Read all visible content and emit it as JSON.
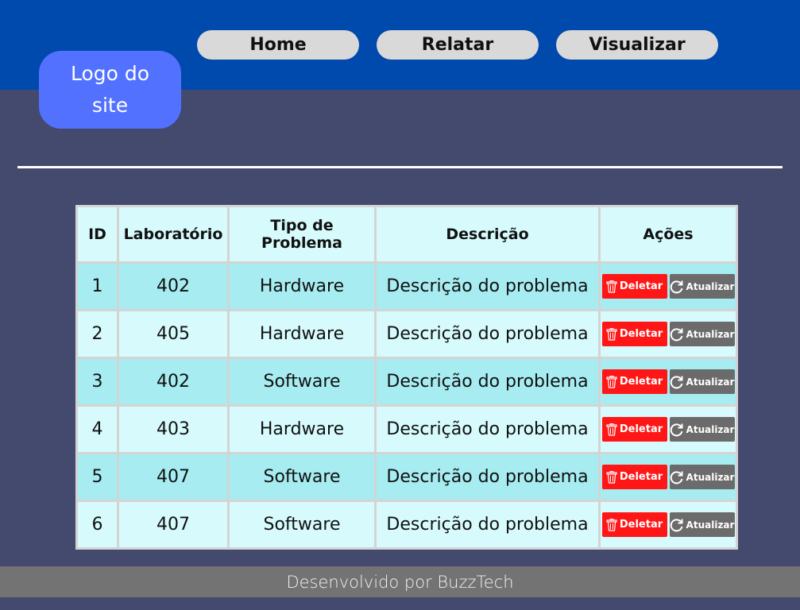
{
  "header": {
    "logo_text": "Logo do site",
    "nav": [
      {
        "label": "Home"
      },
      {
        "label": "Relatar"
      },
      {
        "label": "Visualizar"
      }
    ]
  },
  "table": {
    "headers": [
      "ID",
      "Laboratório",
      "Tipo de Problema",
      "Descrição",
      "Ações"
    ],
    "rows": [
      {
        "id": "1",
        "lab": "402",
        "type": "Hardware",
        "desc": "Descrição do problema"
      },
      {
        "id": "2",
        "lab": "405",
        "type": "Hardware",
        "desc": "Descrição do problema"
      },
      {
        "id": "3",
        "lab": "402",
        "type": "Software",
        "desc": "Descrição do problema"
      },
      {
        "id": "4",
        "lab": "403",
        "type": "Hardware",
        "desc": "Descrição do problema"
      },
      {
        "id": "5",
        "lab": "407",
        "type": "Software",
        "desc": "Descrição do problema"
      },
      {
        "id": "6",
        "lab": "407",
        "type": "Software",
        "desc": "Descrição do problema"
      }
    ],
    "delete_label": "Deletar",
    "update_label": "Atualizar",
    "delete_icon": "trash-icon",
    "update_icon": "refresh-icon"
  },
  "footer": {
    "text": "Desenvolvido por BuzzTech"
  },
  "colors": {
    "header_bg": "#014aad",
    "page_bg": "#434a6e",
    "logo_bg": "#5271ff",
    "nav_bg": "#d9d9d9",
    "row_odd": "#a6ecf1",
    "row_even": "#d7fbfc",
    "delete": "#ff1616",
    "update": "#6b6b6b",
    "footer_bg": "#737373"
  }
}
